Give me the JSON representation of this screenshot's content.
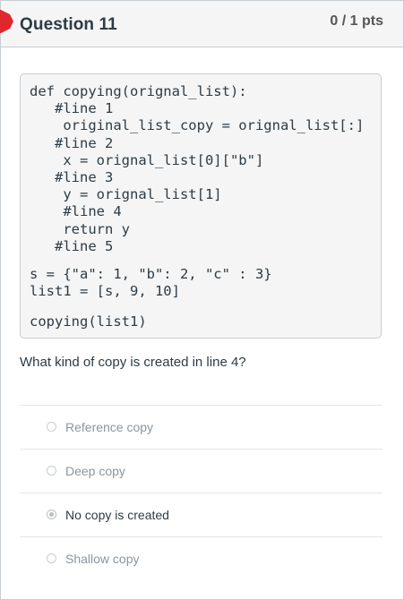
{
  "question": {
    "title": "Question 11",
    "points": "0 / 1 pts",
    "flag_color": "#e0262f"
  },
  "code": {
    "definition": "def copying(orignal_list):\n   #line 1\n    original_list_copy = orignal_list[:]\n   #line 2\n    x = orignal_list[0][\"b\"]\n   #line 3\n    y = orignal_list[1]\n    #line 4\n    return y\n   #line 5",
    "data": "s = {\"a\": 1, \"b\": 2, \"c\" : 3}\nlist1 = [s, 9, 10]",
    "call": "copying(list1)"
  },
  "prompt": "What kind of copy is created in line 4?",
  "answers": [
    {
      "label": "Reference copy",
      "selected": false
    },
    {
      "label": "Deep copy",
      "selected": false
    },
    {
      "label": "No copy is created",
      "selected": true
    },
    {
      "label": "Shallow copy",
      "selected": false
    }
  ]
}
